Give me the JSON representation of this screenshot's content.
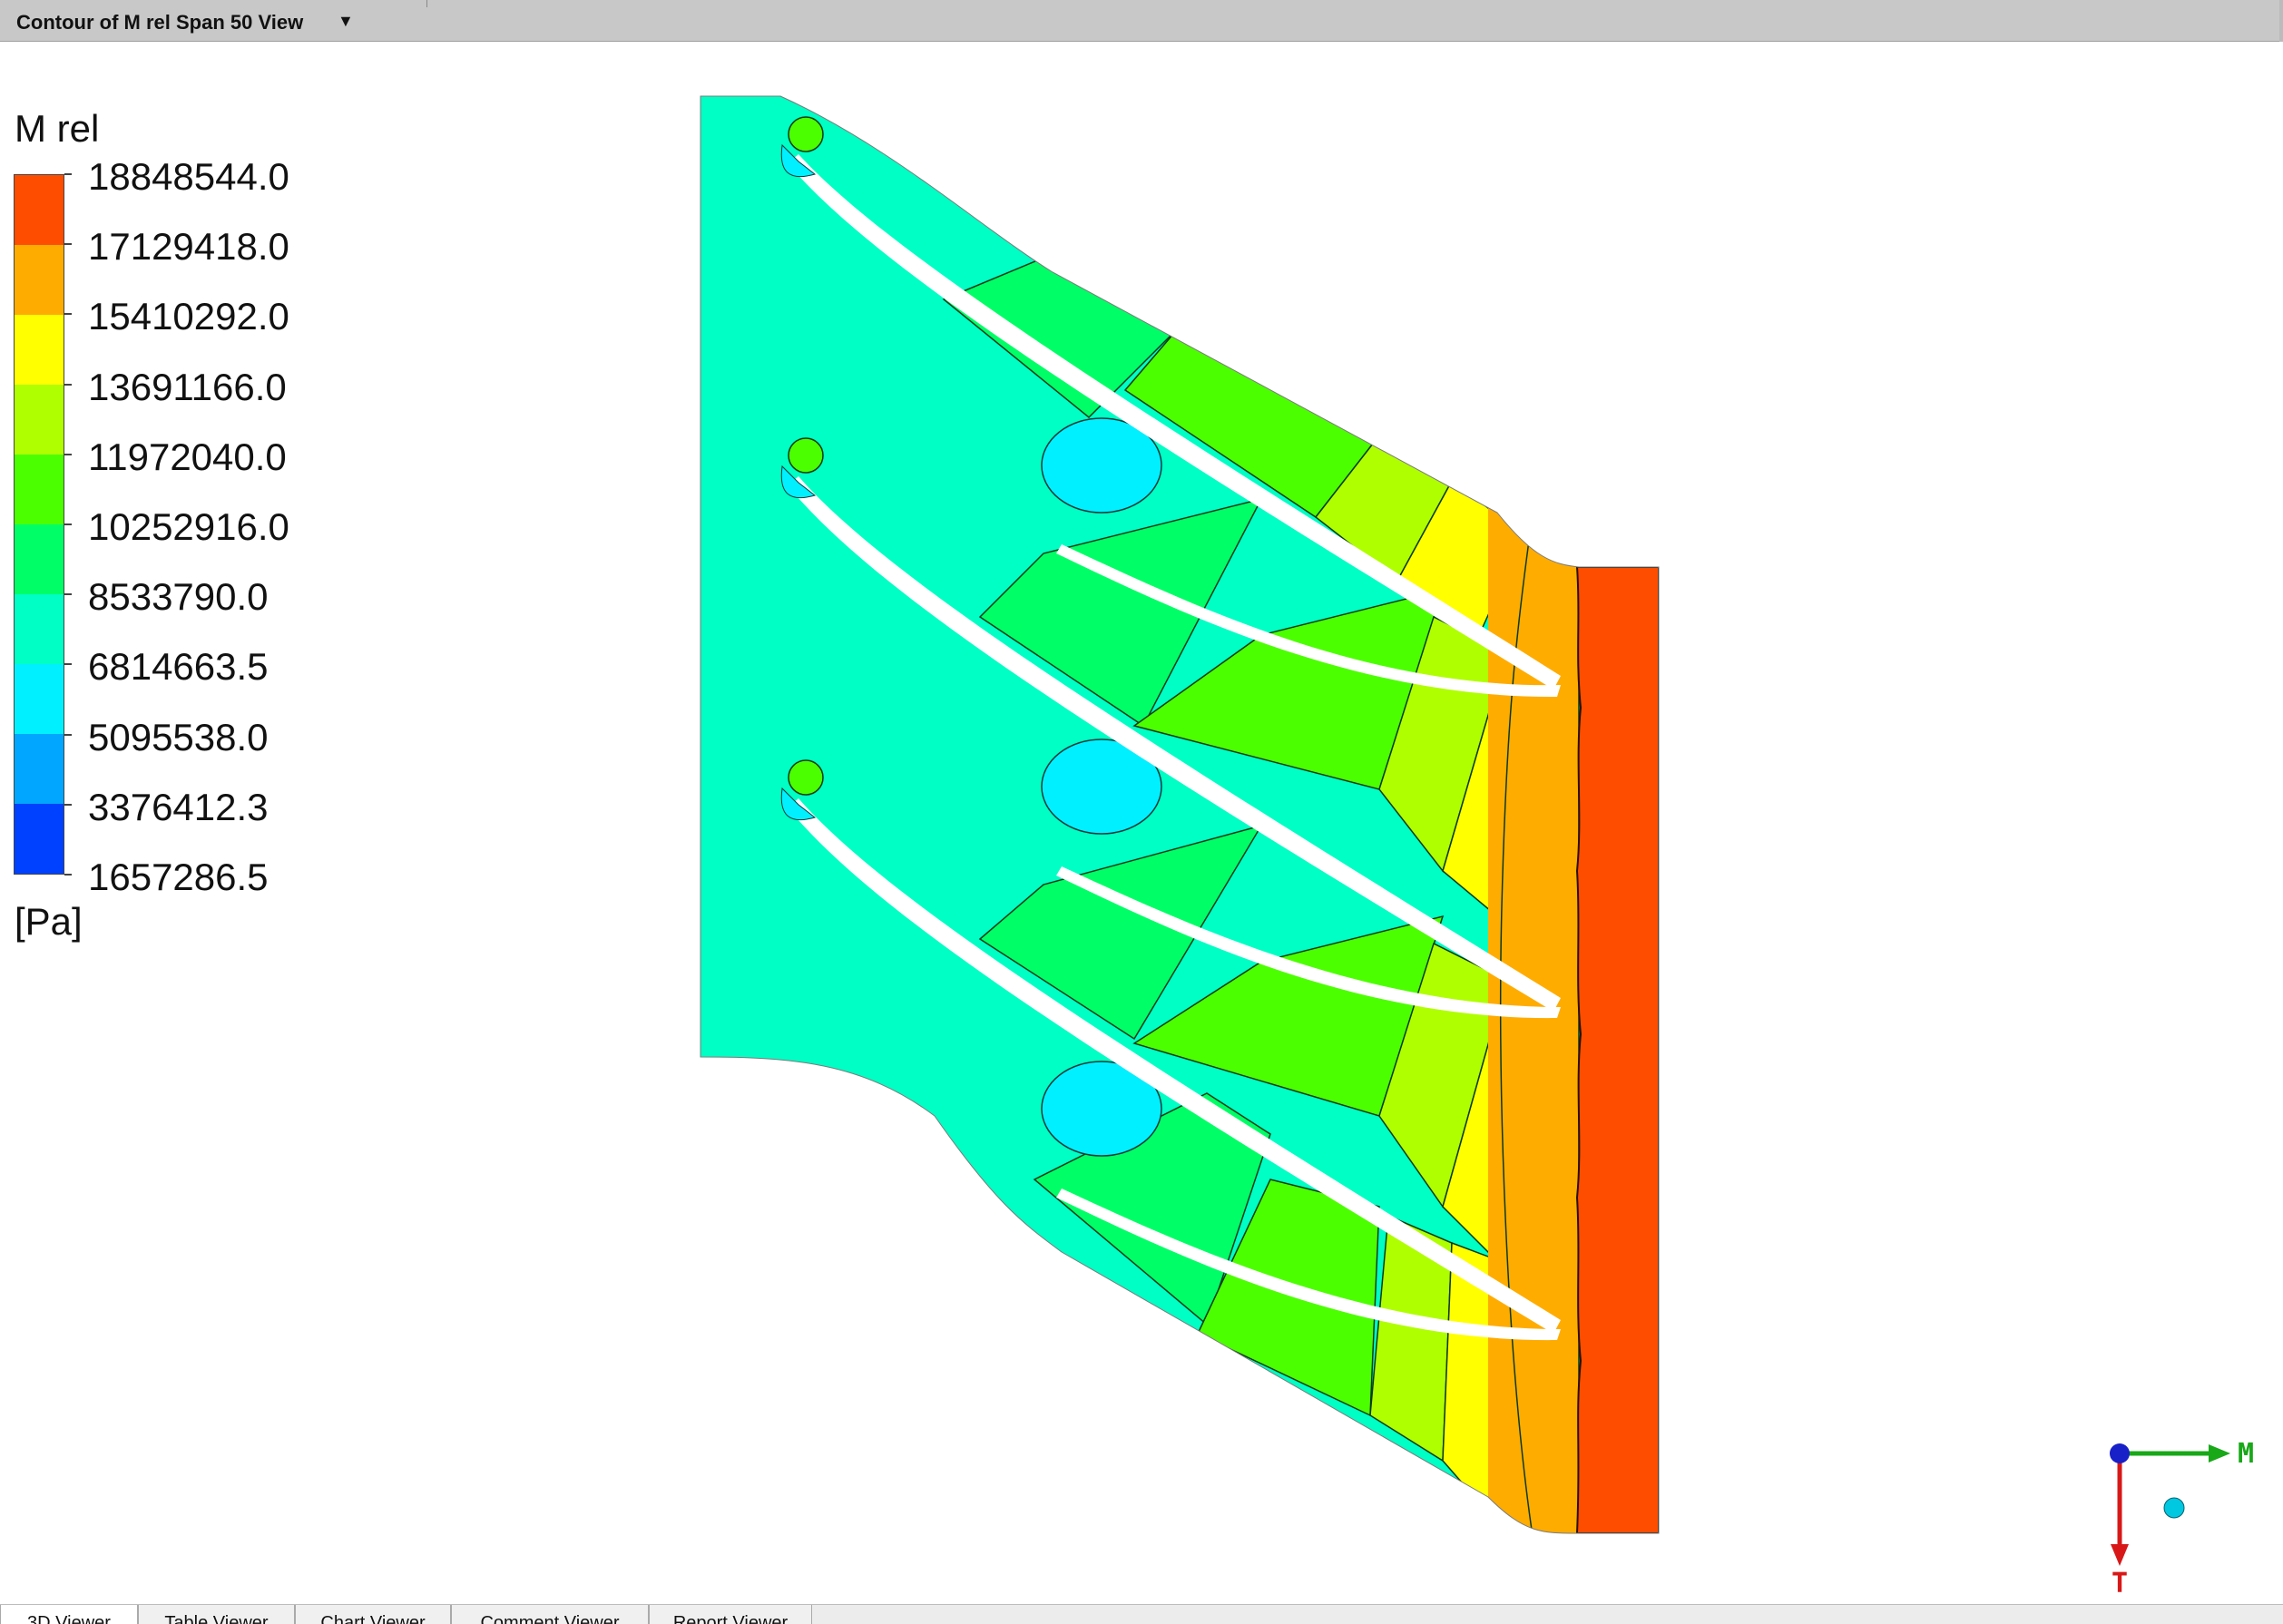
{
  "window": {
    "title": "Contour of M rel Span 50 View"
  },
  "legend": {
    "title": "M rel",
    "unit": "[Pa]",
    "labels": [
      "18848544.0",
      "17129418.0",
      "15410292.0",
      "13691166.0",
      "11972040.0",
      "10252916.0",
      "8533790.0",
      "6814663.5",
      "5095538.0",
      "3376412.3",
      "1657286.5"
    ],
    "colors": [
      "#ff4d00",
      "#ffac00",
      "#ffff00",
      "#b0ff00",
      "#4cff00",
      "#00ff66",
      "#00ffc4",
      "#00f0ff",
      "#00a6ff",
      "#0040ff"
    ]
  },
  "axes": {
    "horizontal": "M",
    "vertical": "T",
    "horizontal_color": "#18a818",
    "vertical_color": "#d81818"
  },
  "tabs": [
    {
      "label": "3D Viewer",
      "active": true
    },
    {
      "label": "Table Viewer",
      "active": false
    },
    {
      "label": "Chart Viewer",
      "active": false
    },
    {
      "label": "Comment Viewer",
      "active": false
    },
    {
      "label": "Report Viewer",
      "active": false
    }
  ]
}
